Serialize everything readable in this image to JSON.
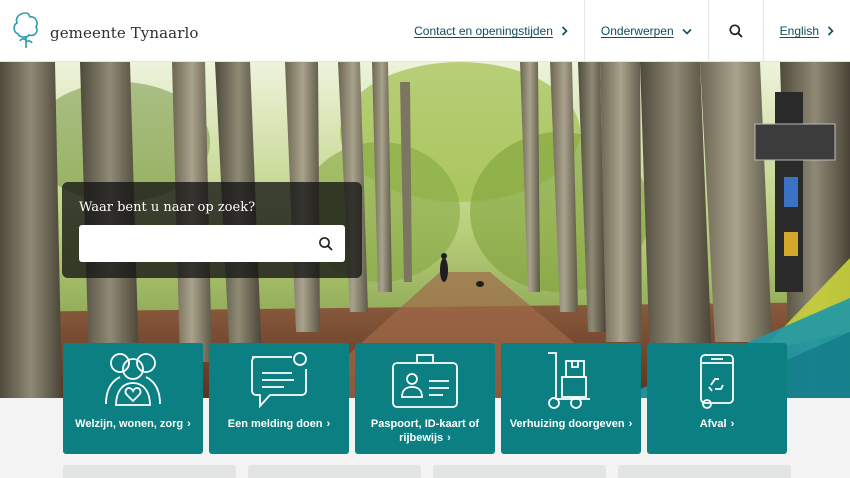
{
  "header": {
    "logo_text": "gemeente Tynaarlo",
    "nav": {
      "contact": "Contact en openingstijden",
      "topics": "Onderwerpen",
      "language": "English"
    }
  },
  "hero": {
    "search_label": "Waar bent u naar op zoek?",
    "search_placeholder": ""
  },
  "tiles": [
    {
      "label": "Welzijn, wonen, zorg",
      "icon": "people-heart-icon"
    },
    {
      "label": "Een melding doen",
      "icon": "chat-bubble-icon"
    },
    {
      "label": "Paspoort, ID-kaart of rijbewijs",
      "icon": "id-card-icon"
    },
    {
      "label": "Verhuizing doorgeven",
      "icon": "hand-truck-icon"
    },
    {
      "label": "Afval",
      "icon": "recycle-bin-icon"
    }
  ],
  "colors": {
    "brand_teal": "#0c7f82",
    "nav_text": "#0e4d5e",
    "search_panel": "#141414"
  }
}
